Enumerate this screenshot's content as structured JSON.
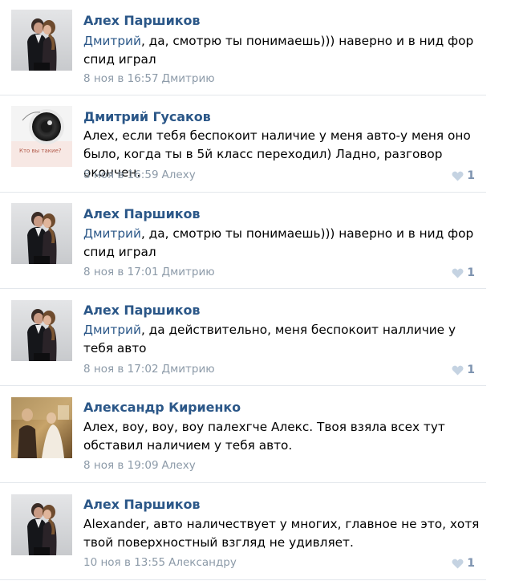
{
  "comments": [
    {
      "author": "Алех Паршиков",
      "mention": "Дмитрий",
      "text": ", да, смотрю ты понимаешь))) наверно и в нид фор спид играл",
      "date": "8 ноя в 16:57",
      "reply_to": "Дмитрию",
      "likes": "",
      "avatar_icon": "couple-photo-avatar"
    },
    {
      "author": "Дмитрий Гусаков",
      "mention": "",
      "text": "Алех, если тебя беспокоит наличие у меня авто-у меня оно было, когда ты в 5й класс переходил) Ладно, разговор окончен.",
      "date": "8 ноя в 16:59",
      "reply_to": "Алеху",
      "likes": "1",
      "avatar_icon": "camera-lens-avatar",
      "avatar_caption": "Кто вы такие?"
    },
    {
      "author": "Алех Паршиков",
      "mention": "Дмитрий",
      "text": ", да, смотрю ты понимаешь))) наверно и в нид фор спид играл",
      "date": "8 ноя в 17:01",
      "reply_to": "Дмитрию",
      "likes": "1",
      "avatar_icon": "couple-photo-avatar"
    },
    {
      "author": "Алех Паршиков",
      "mention": "Дмитрий",
      "text": ", да действительно, меня беспокоит налличие у тебя авто",
      "date": "8 ноя в 17:02",
      "reply_to": "Дмитрию",
      "likes": "1",
      "avatar_icon": "couple-photo-avatar"
    },
    {
      "author": "Александр Кириенко",
      "mention": "",
      "text": "Алех, воу, воу, воу палехгче Алекс. Твоя взяла всех тут обставил наличием у тебя авто.",
      "date": "8 ноя в 19:09",
      "reply_to": "Алеху",
      "likes": "",
      "avatar_icon": "wedding-photo-avatar"
    },
    {
      "author": "Алех Паршиков",
      "mention": "",
      "text": "Alexander, авто наличествует у многих, главное не это, хотя твой поверхностный взгляд не удивляет.",
      "date": "10 ноя в 13:55",
      "reply_to": "Александру",
      "likes": "1",
      "avatar_icon": "couple-photo-avatar"
    }
  ],
  "colors": {
    "author": "#2b5788",
    "meta": "#8c9aa8",
    "like": "#7d93b0",
    "divider": "#e3e7ec"
  }
}
